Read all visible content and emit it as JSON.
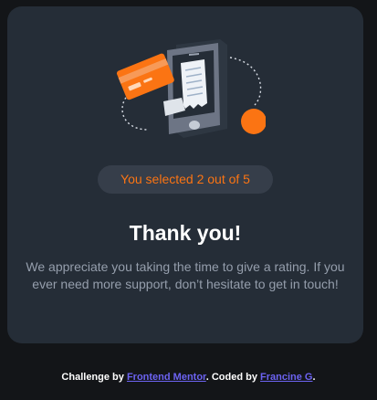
{
  "colors": {
    "background": "#131518",
    "card": "#252d37",
    "accent": "#fb7413",
    "text_muted": "#959eac",
    "link": "#6c63f2"
  },
  "illustration": {
    "icon": "phone-receipt-card-illustration"
  },
  "result": {
    "selected_text": "You selected 2 out of 5",
    "rating": 2,
    "max_rating": 5
  },
  "title": "Thank you!",
  "message": "We appreciate you taking the time to give a rating. If you ever need more support, don’t hesitate to get in touch!",
  "attribution": {
    "prefix": "Challenge by",
    "link1": "Frontend Mentor",
    "middle": ". Coded by",
    "link2": "Francine G",
    "suffix": "."
  }
}
